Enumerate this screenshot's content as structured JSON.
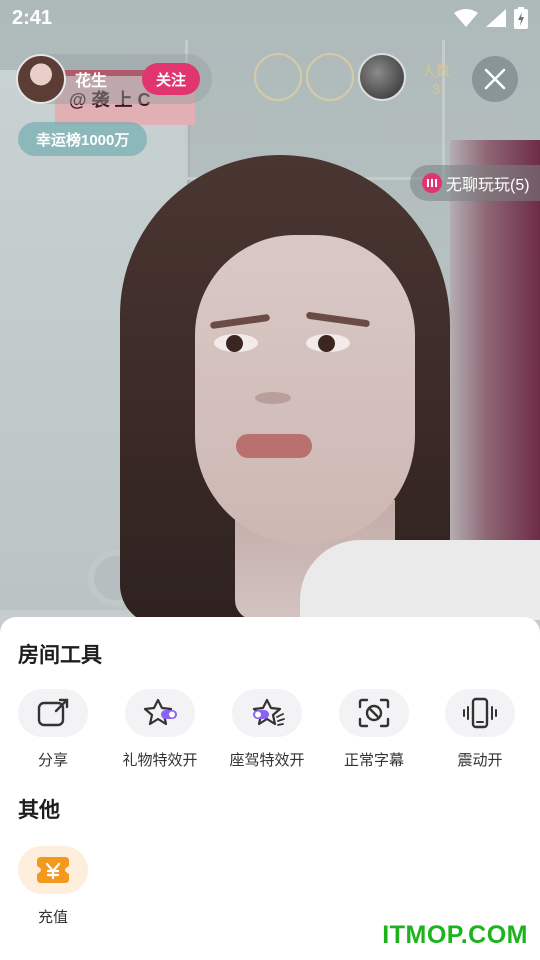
{
  "status_bar": {
    "time": "2:41"
  },
  "host": {
    "name": "花生",
    "follow_label": "关注"
  },
  "lucky_rank": {
    "label": "幸运榜1000万"
  },
  "viewers": {
    "label": "人数",
    "count": "3"
  },
  "bored_tag": {
    "label": "无聊玩玩(5)"
  },
  "poster_text": "@ 袭 上 C",
  "sheet": {
    "room_tools_title": "房间工具",
    "tools": [
      {
        "label": "分享",
        "icon": "share-icon"
      },
      {
        "label": "礼物特效开",
        "icon": "gift-effect-icon"
      },
      {
        "label": "座驾特效开",
        "icon": "vehicle-effect-icon"
      },
      {
        "label": "正常字幕",
        "icon": "subtitle-icon"
      },
      {
        "label": "震动开",
        "icon": "vibrate-icon"
      }
    ],
    "other_title": "其他",
    "others": [
      {
        "label": "充值",
        "icon": "recharge-icon"
      }
    ]
  },
  "watermark": "ITMOP.COM",
  "colors": {
    "accent_pink": "#e0356e",
    "toggle_purple": "#8a63f2",
    "recharge_orange": "#f39a1e",
    "watermark_green": "#1db31d"
  }
}
